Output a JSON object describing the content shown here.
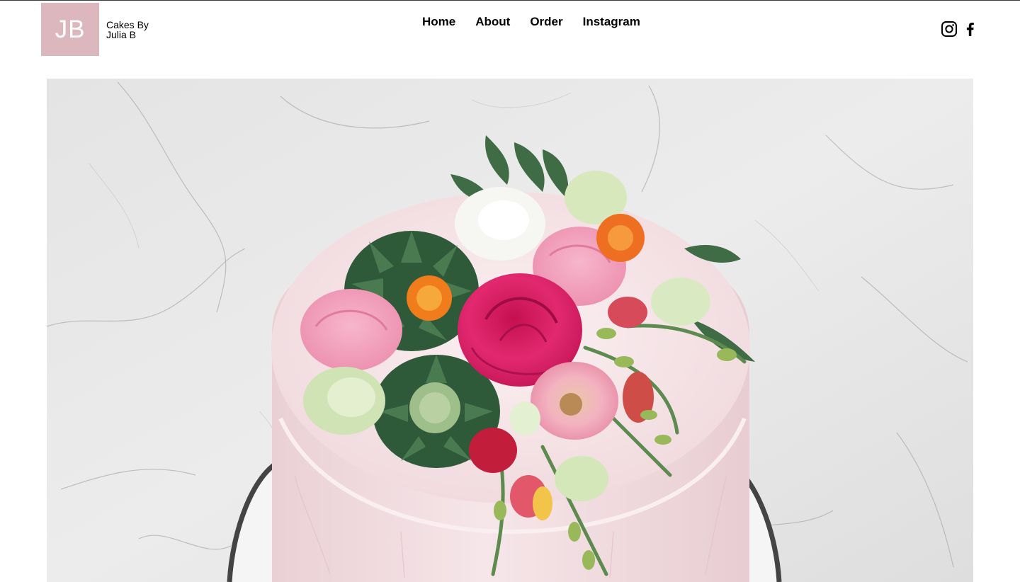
{
  "header": {
    "logo_initials": "JB",
    "brand_line_1": "Cakes By",
    "brand_line_2": "Julia B"
  },
  "nav": {
    "items": [
      {
        "label": "Home"
      },
      {
        "label": "About"
      },
      {
        "label": "Order"
      },
      {
        "label": "Instagram"
      }
    ]
  },
  "social": {
    "icons": [
      "instagram-icon",
      "facebook-icon"
    ]
  },
  "hero": {
    "subject": "pink cake with flowers on marble"
  },
  "colors": {
    "logo_bg": "#dcb7bd",
    "text": "#000000",
    "frosting": "#f3dfe2",
    "rose": "#e0246e"
  }
}
